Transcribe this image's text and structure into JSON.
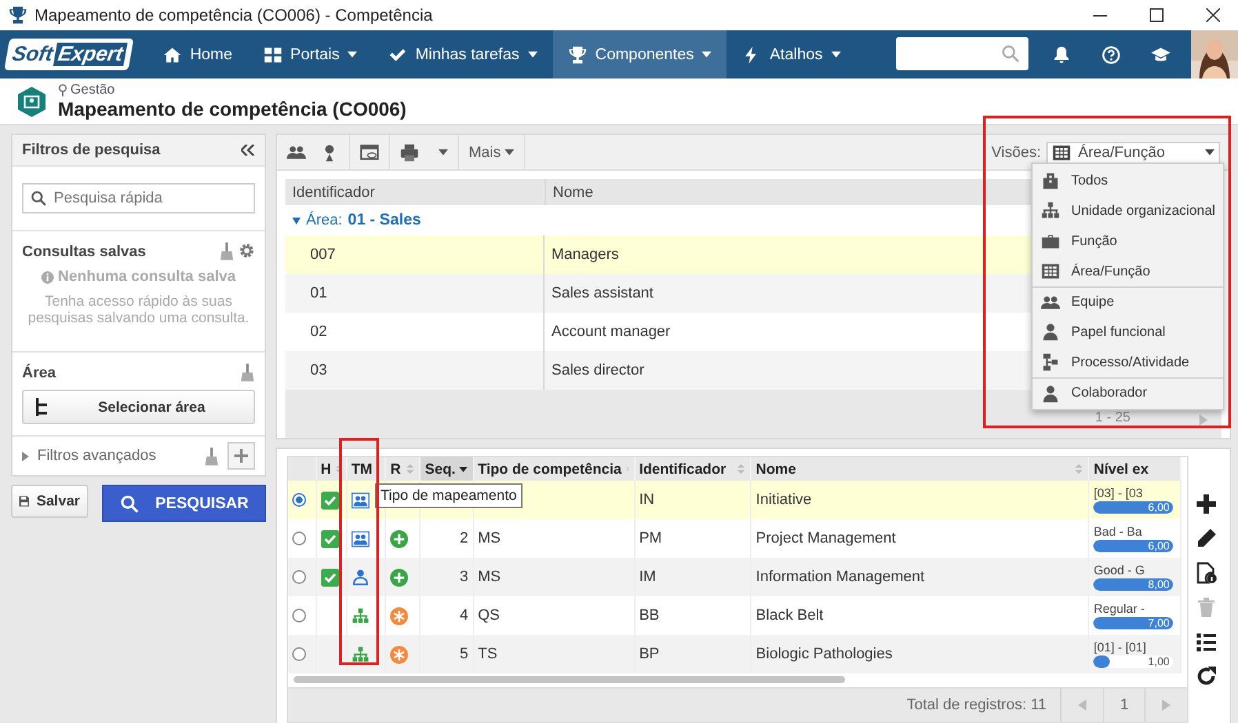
{
  "window": {
    "title": "Mapeamento de competência (CO006) - Competência"
  },
  "nav": {
    "logo": "Soft",
    "logo2": "Expert",
    "items": [
      {
        "label": "Home",
        "dropdown": false,
        "selected": false
      },
      {
        "label": "Portais",
        "dropdown": true,
        "selected": false
      },
      {
        "label": "Minhas tarefas",
        "dropdown": true,
        "selected": false
      },
      {
        "label": "Componentes",
        "dropdown": true,
        "selected": true
      },
      {
        "label": "Atalhos",
        "dropdown": true,
        "selected": false
      }
    ]
  },
  "header": {
    "breadcrumb": "Gestão",
    "title": "Mapeamento de competência (CO006)"
  },
  "filters": {
    "title": "Filtros de pesquisa",
    "search_placeholder": "Pesquisa rápida",
    "saved_title": "Consultas salvas",
    "empty_title": "Nenhuma consulta salva",
    "empty_text": "Tenha acesso rápido às suas pesquisas salvando uma consulta.",
    "area_title": "Área",
    "area_button": "Selecionar área",
    "advanced": "Filtros avançados",
    "expanded": false,
    "save_button": "Salvar",
    "search_button": "PESQUISAR"
  },
  "top": {
    "more": "Mais",
    "views_label": "Visões:",
    "views_value": "Área/Função",
    "views_options": [
      {
        "label": "Todos",
        "separator_before": false
      },
      {
        "label": "Unidade organizacional",
        "separator_before": false
      },
      {
        "label": "Função",
        "separator_before": false
      },
      {
        "label": "Área/Função",
        "separator_before": false
      },
      {
        "label": "Equipe",
        "separator_before": true
      },
      {
        "label": "Papel funcional",
        "separator_before": false
      },
      {
        "label": "Processo/Atividade",
        "separator_before": false
      },
      {
        "label": "Colaborador",
        "separator_before": true
      }
    ],
    "columns": [
      "Identificador",
      "Nome"
    ],
    "group": {
      "label": "Área:",
      "value": "01 - Sales",
      "expanded": true
    },
    "rows": [
      {
        "id": "007",
        "name": "Managers",
        "selected": true
      },
      {
        "id": "01",
        "name": "Sales assistant",
        "selected": false
      },
      {
        "id": "02",
        "name": "Account manager",
        "selected": false
      },
      {
        "id": "03",
        "name": "Sales director",
        "selected": false
      }
    ],
    "pager": "1 - 25"
  },
  "bottom": {
    "columns": [
      {
        "label": "H",
        "sortable": true,
        "sorted": false
      },
      {
        "label": "TM",
        "sortable": false,
        "sorted": false
      },
      {
        "label": "R",
        "sortable": true,
        "sorted": false
      },
      {
        "label": "Seq.",
        "sortable": true,
        "sorted": true
      },
      {
        "label": "Tipo de competência",
        "sortable": true,
        "sorted": false
      },
      {
        "label": "Identificador",
        "sortable": true,
        "sorted": false
      },
      {
        "label": "Nome",
        "sortable": true,
        "sorted": false
      },
      {
        "label": "Nível ex",
        "sortable": false,
        "sorted": false
      }
    ],
    "rows": [
      {
        "selected": true,
        "h": true,
        "tm": {
          "kind": "team"
        },
        "seq": "",
        "type": "",
        "identifier": "IN",
        "name": "Initiative",
        "level_label": "[03] - [03",
        "level": 1,
        "level_value": "6,00"
      },
      {
        "selected": false,
        "h": true,
        "tm": {
          "kind": "team"
        },
        "r": {
          "kind": "plus"
        },
        "seq": "2",
        "type": "MS",
        "identifier": "PM",
        "name": "Project Management",
        "level_label": "Bad - Ba",
        "level": 1,
        "level_value": "6,00"
      },
      {
        "selected": false,
        "h": true,
        "tm": {
          "kind": "person"
        },
        "r": {
          "kind": "plus"
        },
        "seq": "3",
        "type": "MS",
        "identifier": "IM",
        "name": "Information Management",
        "level_label": "Good - G",
        "level": 1,
        "level_value": "8,00"
      },
      {
        "selected": false,
        "h": false,
        "tm": {
          "kind": "org"
        },
        "r": {
          "kind": "star"
        },
        "seq": "4",
        "type": "QS",
        "identifier": "BB",
        "name": "Black Belt",
        "level_label": "Regular -",
        "level": 1,
        "level_value": "7,00"
      },
      {
        "selected": false,
        "h": false,
        "tm": {
          "kind": "org"
        },
        "r": {
          "kind": "star"
        },
        "seq": "5",
        "type": "TS",
        "identifier": "BP",
        "name": "Biologic Pathologies",
        "level_label": "[01] - [01]",
        "level": 0.2,
        "level_value": "1,00"
      }
    ],
    "tooltip": "Tipo de mapeamento",
    "total": "Total de registros: 11",
    "page": "1"
  }
}
